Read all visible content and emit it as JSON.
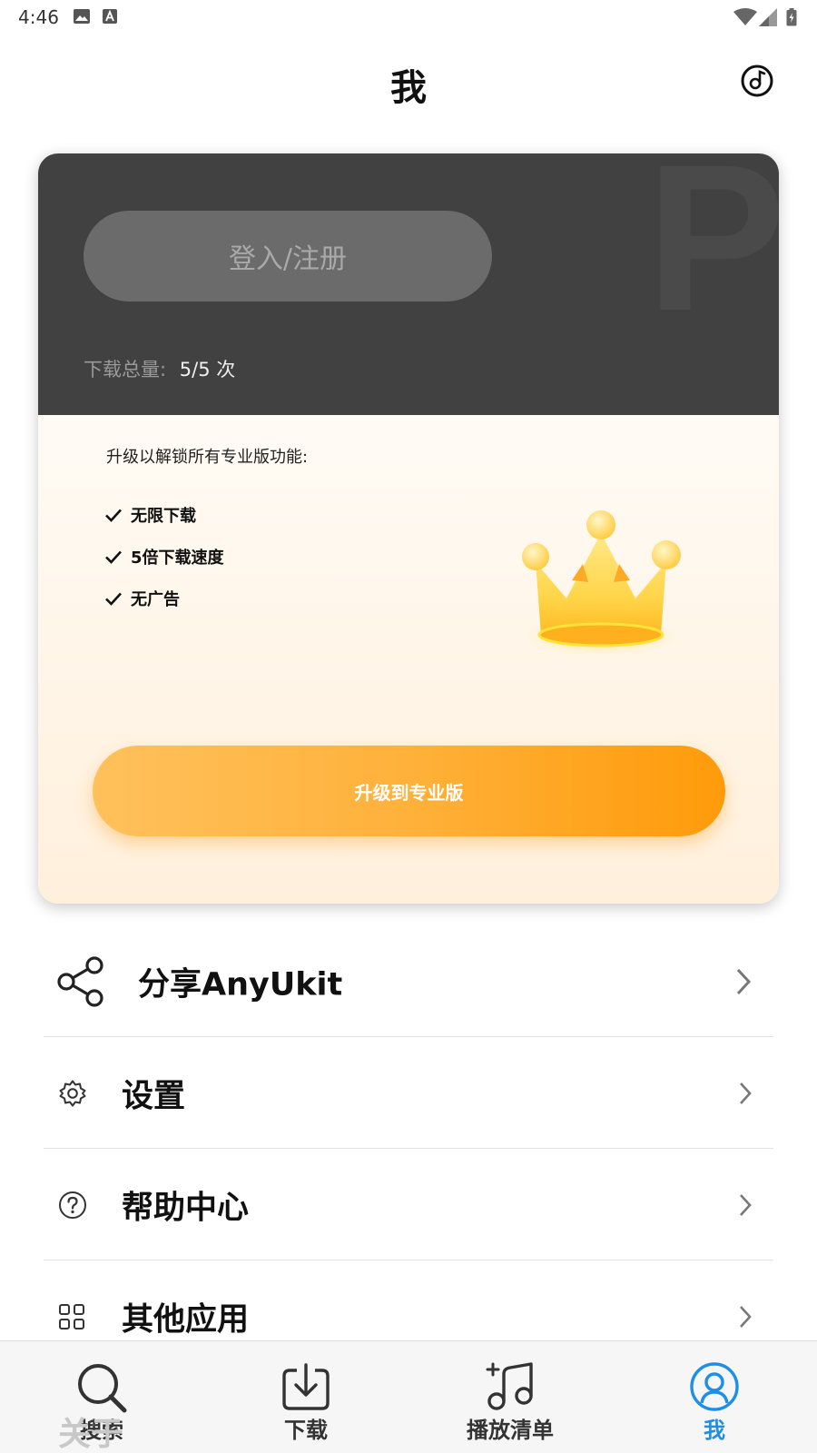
{
  "status_bar": {
    "time": "4:46"
  },
  "header": {
    "title": "我"
  },
  "card": {
    "watermark": "P",
    "login_label": "登入/注册",
    "download_total_label": "下载总量:",
    "download_total_value": "5/5 次",
    "upgrade_heading": "升级以解锁所有专业版功能:",
    "features": [
      "无限下载",
      "5倍下载速度",
      "无广告"
    ],
    "upgrade_button": "升级到专业版"
  },
  "menu": [
    {
      "label": "分享AnyUkit",
      "icon": "share-icon"
    },
    {
      "label": "设置",
      "icon": "gear-icon"
    },
    {
      "label": "帮助中心",
      "icon": "help-icon"
    },
    {
      "label": "其他应用",
      "icon": "grid-icon"
    }
  ],
  "ghost_item": "关于",
  "bottom_nav": [
    {
      "label": "搜索",
      "icon": "search-icon",
      "active": false
    },
    {
      "label": "下载",
      "icon": "download-icon",
      "active": false
    },
    {
      "label": "播放清单",
      "icon": "music-add-icon",
      "active": false
    },
    {
      "label": "我",
      "icon": "user-icon",
      "active": true
    }
  ],
  "colors": {
    "accent": "#1e8fe6",
    "upgrade": "#ffa91f",
    "card_dark": "#414141"
  }
}
